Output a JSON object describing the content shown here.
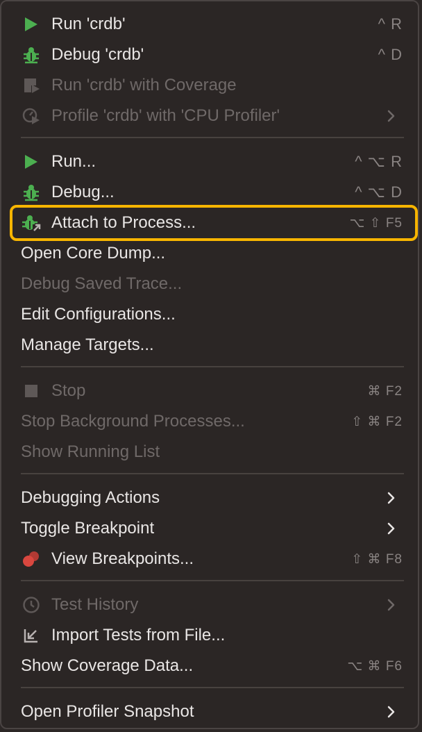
{
  "menu": {
    "groups": [
      {
        "items": [
          {
            "label": "Run 'crdb'",
            "shortcut": "^ R",
            "icon": "run-icon",
            "enabled": true
          },
          {
            "label": "Debug 'crdb'",
            "shortcut": "^ D",
            "icon": "debug-icon",
            "enabled": true
          },
          {
            "label": "Run 'crdb' with Coverage",
            "icon": "coverage-icon",
            "enabled": false
          },
          {
            "label": "Profile 'crdb' with 'CPU Profiler'",
            "icon": "profiler-icon",
            "enabled": false,
            "submenu": true
          }
        ]
      },
      {
        "items": [
          {
            "label": "Run...",
            "shortcut": "^ ⌥ R",
            "icon": "run-icon",
            "enabled": true
          },
          {
            "label": "Debug...",
            "shortcut": "^ ⌥ D",
            "icon": "debug-icon",
            "enabled": true
          },
          {
            "label": "Attach to Process...",
            "shortcut": "⌥ ⇧ F5",
            "icon": "attach-process-icon",
            "enabled": true,
            "highlighted": true
          },
          {
            "label": "Open Core Dump...",
            "enabled": true
          },
          {
            "label": "Debug Saved Trace...",
            "enabled": false
          },
          {
            "label": "Edit Configurations...",
            "enabled": true
          },
          {
            "label": "Manage Targets...",
            "enabled": true
          }
        ]
      },
      {
        "items": [
          {
            "label": "Stop",
            "shortcut": "⌘ F2",
            "icon": "stop-icon",
            "enabled": false
          },
          {
            "label": "Stop Background Processes...",
            "shortcut": "⇧ ⌘ F2",
            "enabled": false
          },
          {
            "label": "Show Running List",
            "enabled": false
          }
        ]
      },
      {
        "items": [
          {
            "label": "Debugging Actions",
            "enabled": true,
            "submenu": true
          },
          {
            "label": "Toggle Breakpoint",
            "enabled": true,
            "submenu": true
          },
          {
            "label": "View Breakpoints...",
            "shortcut": "⇧ ⌘ F8",
            "icon": "breakpoints-icon",
            "enabled": true
          }
        ]
      },
      {
        "items": [
          {
            "label": "Test History",
            "icon": "clock-icon",
            "enabled": false,
            "submenu": true
          },
          {
            "label": "Import Tests from File...",
            "icon": "import-icon",
            "enabled": true
          },
          {
            "label": "Show Coverage Data...",
            "shortcut": "⌥ ⌘ F6",
            "enabled": true
          }
        ]
      },
      {
        "items": [
          {
            "label": "Open Profiler Snapshot",
            "enabled": true,
            "submenu": true
          }
        ]
      }
    ],
    "colors": {
      "background": "#2b2625",
      "text": "#e9e6e5",
      "disabled": "#6f6968",
      "highlight": "#f7b500",
      "run_green": "#4caf50",
      "breakpoint_red": "#d9473f"
    }
  }
}
